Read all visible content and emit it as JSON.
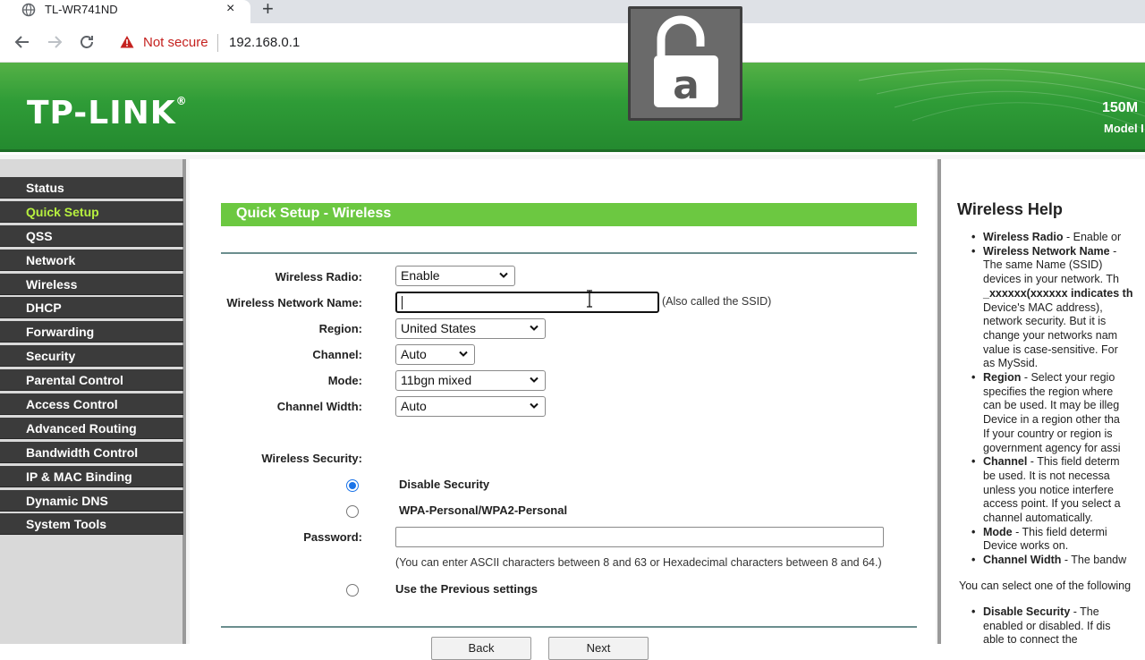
{
  "browser": {
    "tab_title": "TL-WR741ND",
    "tab_close": "×",
    "new_tab": "+",
    "security_label": "Not secure",
    "url": "192.168.0.1"
  },
  "header": {
    "logo": "TP-LINK",
    "logo_mark": "®",
    "speed_partial": "150M",
    "model_partial": "Model I"
  },
  "lock_overlay": {
    "letter": "a"
  },
  "sidebar": {
    "items": [
      {
        "label": "Status",
        "active": false
      },
      {
        "label": "Quick Setup",
        "active": true
      },
      {
        "label": "QSS",
        "active": false
      },
      {
        "label": "Network",
        "active": false
      },
      {
        "label": "Wireless",
        "active": false
      },
      {
        "label": "DHCP",
        "active": false
      },
      {
        "label": "Forwarding",
        "active": false
      },
      {
        "label": "Security",
        "active": false
      },
      {
        "label": "Parental Control",
        "active": false
      },
      {
        "label": "Access Control",
        "active": false
      },
      {
        "label": "Advanced Routing",
        "active": false
      },
      {
        "label": "Bandwidth Control",
        "active": false
      },
      {
        "label": "IP & MAC Binding",
        "active": false
      },
      {
        "label": "Dynamic DNS",
        "active": false
      },
      {
        "label": "System Tools",
        "active": false
      }
    ]
  },
  "main": {
    "section_title": "Quick Setup - Wireless",
    "form": {
      "wireless_radio": {
        "label": "Wireless Radio:",
        "value": "Enable"
      },
      "network_name": {
        "label": "Wireless Network Name:",
        "value": "",
        "hint": "(Also called the SSID)"
      },
      "region": {
        "label": "Region:",
        "value": "United States"
      },
      "channel": {
        "label": "Channel:",
        "value": "Auto"
      },
      "mode": {
        "label": "Mode:",
        "value": "11bgn mixed"
      },
      "channel_width": {
        "label": "Channel Width:",
        "value": "Auto"
      }
    },
    "security": {
      "label": "Wireless Security:",
      "options": [
        {
          "label": "Disable Security",
          "checked": true
        },
        {
          "label": "WPA-Personal/WPA2-Personal",
          "checked": false
        },
        {
          "label": "Use the Previous settings",
          "checked": false
        }
      ],
      "password_label": "Password:",
      "password_value": "",
      "password_hint": "(You can enter ASCII characters between 8 and 63 or Hexadecimal characters between 8 and 64.)"
    },
    "buttons": {
      "back": "Back",
      "next": "Next"
    }
  },
  "help": {
    "title": "Wireless Help",
    "items": [
      {
        "term": "Wireless Radio",
        "lines": [
          " - Enable or"
        ]
      },
      {
        "term": "Wireless Network Name",
        "lines": [
          " - ",
          "The same Name (SSID)",
          "devices in your network. Th",
          "_xxxxxx(xxxxxx indicates th",
          "Device's MAC address),",
          "network security. But it is",
          "change your networks nam",
          "value is case-sensitive. For",
          "as MySsid."
        ]
      },
      {
        "term": "Region",
        "lines": [
          " - Select your regio",
          "specifies the region where",
          "can be used. It may be illeg",
          "Device in a region other tha",
          "If your country or region is",
          "government agency for assi"
        ]
      },
      {
        "term": "Channel",
        "lines": [
          " - This field determ",
          "be used. It is not necessa",
          "unless you notice interfere",
          "access point. If you select a",
          "channel automatically."
        ]
      },
      {
        "term": "Mode",
        "lines": [
          " - This field determi",
          "Device works on."
        ]
      },
      {
        "term": "Channel Width",
        "lines": [
          " - The bandw"
        ]
      }
    ],
    "mid_text": "You can select one of the following",
    "items2": [
      {
        "term": "Disable Security",
        "lines": [
          " - The",
          "enabled or disabled. If dis",
          "able to connect the"
        ]
      }
    ]
  },
  "colors": {
    "header_green": "#2f9c37",
    "section_green": "#6cc841",
    "menu_bg": "#3b3b3b",
    "menu_active": "#b7f03f",
    "not_secure": "#c5221f"
  }
}
